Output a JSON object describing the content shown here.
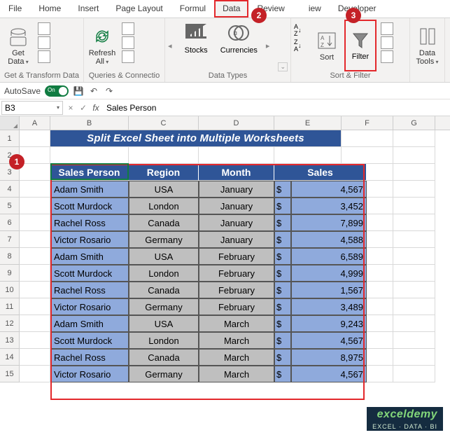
{
  "tabs": [
    "File",
    "Home",
    "Insert",
    "Page Layout",
    "Formul",
    "Data",
    "Review",
    "iew",
    "Developer"
  ],
  "active_tab": "Data",
  "ribbon": {
    "get_data": "Get Data",
    "group_getdata": "Get & Transform Data",
    "refresh_all": "Refresh All",
    "group_queries": "Queries & Connectio",
    "stocks": "Stocks",
    "currencies": "Currencies",
    "group_types": "Data Types",
    "sort": "Sort",
    "filter": "Filter",
    "group_sortfilter": "Sort & Filter",
    "data_tools": "Data Tools",
    "az": "A→Z",
    "za": "Z→A"
  },
  "autosave_label": "AutoSave",
  "namebox": "B3",
  "fx": "fx",
  "formula": "Sales Person",
  "cols": [
    "A",
    "B",
    "C",
    "D",
    "E",
    "F",
    "G"
  ],
  "banner": "Split Excel Sheet into Multiple Worksheets",
  "table": {
    "headers": [
      "Sales Person",
      "Region",
      "Month",
      "Sales"
    ],
    "currency": "$",
    "rows": [
      {
        "n": "Adam Smith",
        "r": "USA",
        "m": "January",
        "v": "4,567"
      },
      {
        "n": "Scott Murdock",
        "r": "London",
        "m": "January",
        "v": "3,452"
      },
      {
        "n": "Rachel Ross",
        "r": "Canada",
        "m": "January",
        "v": "7,899"
      },
      {
        "n": "Victor Rosario",
        "r": "Germany",
        "m": "January",
        "v": "4,588"
      },
      {
        "n": "Adam Smith",
        "r": "USA",
        "m": "February",
        "v": "6,589"
      },
      {
        "n": "Scott Murdock",
        "r": "London",
        "m": "February",
        "v": "4,999"
      },
      {
        "n": "Rachel Ross",
        "r": "Canada",
        "m": "February",
        "v": "1,567"
      },
      {
        "n": "Victor Rosario",
        "r": "Germany",
        "m": "February",
        "v": "3,489"
      },
      {
        "n": "Adam Smith",
        "r": "USA",
        "m": "March",
        "v": "9,243"
      },
      {
        "n": "Scott Murdock",
        "r": "London",
        "m": "March",
        "v": "4,567"
      },
      {
        "n": "Rachel Ross",
        "r": "Canada",
        "m": "March",
        "v": "8,975"
      },
      {
        "n": "Victor Rosario",
        "r": "Germany",
        "m": "March",
        "v": "4,567"
      }
    ]
  },
  "row_nums": [
    "1",
    "2",
    "3",
    "4",
    "5",
    "6",
    "7",
    "8",
    "9",
    "10",
    "11",
    "12",
    "13",
    "14",
    "15"
  ],
  "badges": {
    "b1": "1",
    "b2": "2",
    "b3": "3"
  },
  "watermark": {
    "l1": "exceldemy",
    "l2": "EXCEL · DATA · BI"
  }
}
